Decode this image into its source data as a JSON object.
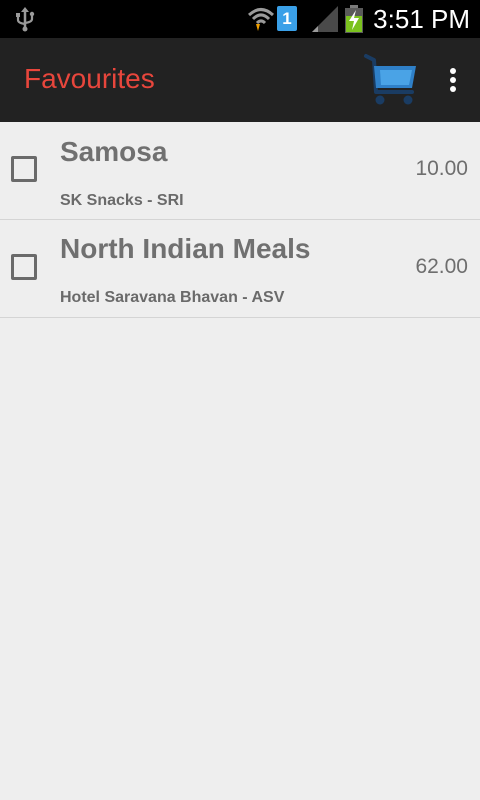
{
  "status_bar": {
    "time": "3:51 PM",
    "sim_slot": "1",
    "icons": [
      "usb-icon",
      "wifi-icon",
      "sim-icon",
      "signal-icon",
      "battery-charging-icon"
    ]
  },
  "action_bar": {
    "title": "Favourites",
    "title_color": "#e8463c",
    "actions": [
      "cart-icon",
      "overflow-menu-icon"
    ]
  },
  "favourites": [
    {
      "name": "Samosa",
      "shop": "SK Snacks - SRI",
      "price": "10.00",
      "checked": false
    },
    {
      "name": "North Indian Meals",
      "shop": "Hotel Saravana Bhavan - ASV",
      "price": "62.00",
      "checked": false
    }
  ]
}
